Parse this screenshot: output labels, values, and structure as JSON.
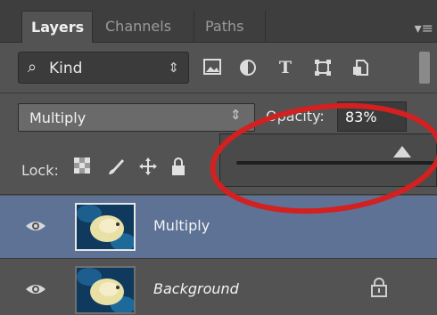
{
  "tabs": {
    "layers": "Layers",
    "channels": "Channels",
    "paths": "Paths"
  },
  "filter": {
    "kind_label": "Kind",
    "icons": [
      "image-filter-icon",
      "adjustment-filter-icon",
      "type-filter-icon",
      "shape-filter-icon",
      "smart-object-filter-icon"
    ],
    "type_glyph": "T"
  },
  "blend": {
    "mode": "Multiply",
    "opacity_label": "Opacity:",
    "opacity_value": "83%"
  },
  "slider": {
    "value": 83
  },
  "lock": {
    "label": "Lock:"
  },
  "layers": [
    {
      "name": "Multiply",
      "selected": true,
      "visible": true,
      "locked": false
    },
    {
      "name": "Background",
      "selected": false,
      "visible": true,
      "locked": true
    }
  ],
  "colors": {
    "panel": "#535353",
    "selection": "#5d7294",
    "annotation": "#d32020"
  }
}
